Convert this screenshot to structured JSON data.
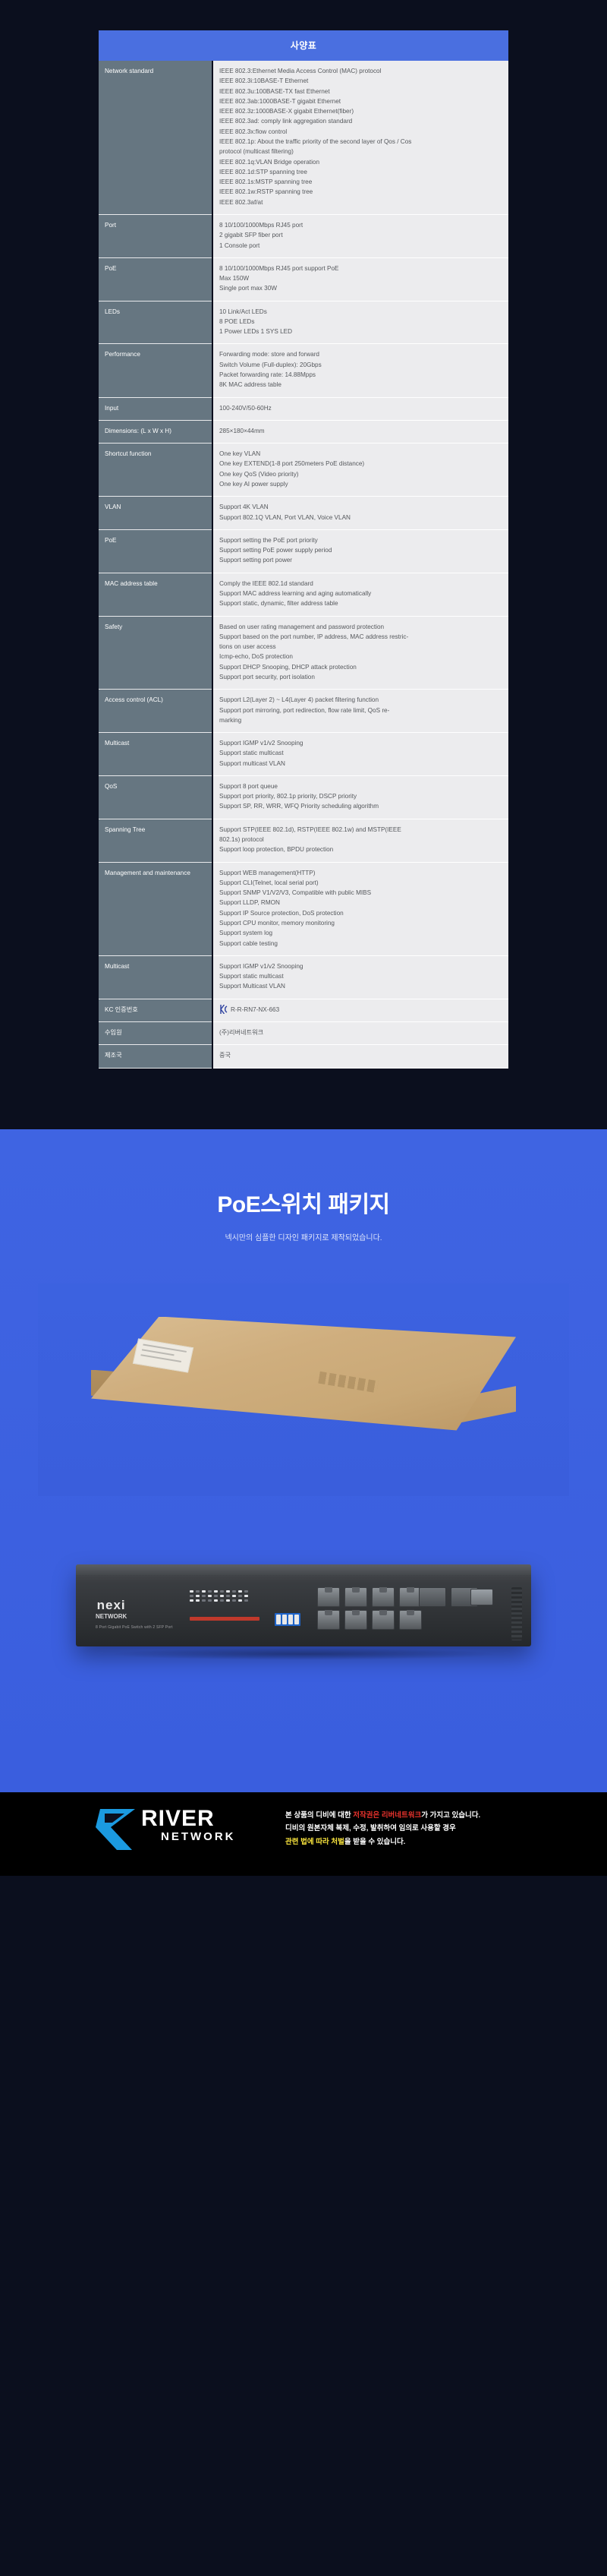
{
  "spec": {
    "header_title": "사양표",
    "rows": [
      {
        "label": "Network standard",
        "lines": [
          "IEEE 802.3:Ethernet Media Access Control (MAC) protocol",
          "IEEE 802.3i:10BASE-T Ethernet",
          "IEEE 802.3u:100BASE-TX fast Ethernet",
          "IEEE 802.3ab:1000BASE-T gigabit Ethernet",
          "IEEE 802.3z:1000BASE-X gigabit Ethernet(fiber)",
          "IEEE 802.3ad: comply link aggregation standard",
          "IEEE 802.3x:flow control",
          "IEEE 802.1p: About the traffic priority of the second layer of Qos / Cos",
          "protocol (multicast filtering)",
          "IEEE 802.1q:VLAN Bridge operation",
          "IEEE 802.1d:STP spanning tree",
          "IEEE 802.1s:MSTP spanning tree",
          "IEEE 802.1w:RSTP spanning tree",
          "IEEE 802.3af/at"
        ]
      },
      {
        "label": "Port",
        "lines": [
          "8 10/100/1000Mbps RJ45 port",
          "2 gigabit SFP fiber port",
          "1 Console port"
        ]
      },
      {
        "label": "PoE",
        "lines": [
          "8 10/100/1000Mbps RJ45 port support PoE",
          "Max 150W",
          "Single port max 30W"
        ]
      },
      {
        "label": "LEDs",
        "lines": [
          "10 Link/Act LEDs",
          "8 POE LEDs",
          "1 Power LEDs 1 SYS LED"
        ]
      },
      {
        "label": "Performance",
        "lines": [
          "Forwarding mode: store and forward",
          "Switch Volume (Full-duplex): 20Gbps",
          "Packet forwarding rate: 14.88Mpps",
          "8K MAC address table"
        ]
      },
      {
        "label": "Input",
        "lines": [
          "100-240V/50-60Hz"
        ]
      },
      {
        "label": "Dimensions: (L x W x H)",
        "lines": [
          "285×180×44mm"
        ]
      },
      {
        "label": "Shortcut function",
        "lines": [
          "One key VLAN",
          "One key EXTEND(1-8 port 250meters PoE distance)",
          "One key QoS (Video priority)",
          "One key AI power supply"
        ]
      },
      {
        "label": "VLAN",
        "lines": [
          "Support 4K VLAN",
          "Support 802.1Q VLAN, Port VLAN, Voice VLAN"
        ]
      },
      {
        "label": "PoE",
        "lines": [
          "Support setting the PoE port priority",
          "Support setting PoE power supply period",
          "Support setting port power"
        ]
      },
      {
        "label": "MAC address table",
        "lines": [
          "Comply the IEEE 802.1d standard",
          "Support MAC address learning and aging automatically",
          "Support static, dynamic, filter address table"
        ]
      },
      {
        "label": "Safety",
        "lines": [
          "Based on user rating management and password protection",
          "Support based on the port number, IP address, MAC address restric-",
          "tions on user access",
          "Icmp-echo, DoS protection",
          "Support DHCP Snooping, DHCP attack protection",
          "Support port security, port isolation"
        ]
      },
      {
        "label": "Access control (ACL)",
        "lines": [
          "Support L2(Layer 2) ~ L4(Layer 4) packet filtering function",
          "Support port mirroring, port redirection, flow rate limit, QoS re-",
          "marking"
        ]
      },
      {
        "label": "Multicast",
        "lines": [
          "Support IGMP v1/v2 Snooping",
          "Support static multicast",
          "Support multicast VLAN"
        ]
      },
      {
        "label": "QoS",
        "lines": [
          "Support 8 port queue",
          "Support port priority, 802.1p priority, DSCP priority",
          "Support SP, RR, WRR, WFQ Priority scheduling algorithm"
        ]
      },
      {
        "label": "Spanning Tree",
        "lines": [
          "Support STP(IEEE 802.1d), RSTP(IEEE 802.1w) and MSTP(IEEE",
          "802.1s) protocol",
          "Support loop protection, BPDU protection"
        ]
      },
      {
        "label": "Management and maintenance",
        "lines": [
          "Support WEB management(HTTP)",
          "Support CLI(Telnet, local serial port)",
          "Support SNMP V1/V2/V3, Compatible with public MIBS",
          "Support LLDP, RMON",
          "Support IP Source protection, DoS protection",
          "Support CPU monitor, memory monitoring",
          "Support system log",
          "Support cable testing"
        ]
      },
      {
        "label": "Multicast",
        "lines": [
          "Support IGMP v1/v2 Snooping",
          "Support static multicast",
          "Support Multicast VLAN"
        ]
      },
      {
        "label": "KC 인증번호",
        "kc_icon": "kc-certification-mark",
        "lines": [
          "R-R-RN7-NX-663"
        ]
      },
      {
        "label": "수입원",
        "lines": [
          "(주)리버네트워크"
        ]
      },
      {
        "label": "제조국",
        "lines": [
          "중국"
        ]
      }
    ]
  },
  "package": {
    "title": "PoE스위치 패키지",
    "subtitle": "넥시만의 심플한 디자인 패키지로 제작되었습니다.",
    "box_photo_name": "product-box-photo",
    "switch_photo_name": "poe-switch-photo",
    "switch_brand": "nexi",
    "switch_brand_sub": "NETWORK",
    "switch_model": "8 Port Gigabit PoE Switch with 2 SFP Port"
  },
  "footer": {
    "logo_main": "RIVER",
    "logo_sub": "NETWORK",
    "line1_a": "본 상품의 디비에 대한 ",
    "line1_b": "저작권은 리버네트워크",
    "line1_c": "가 가지고 있습니다.",
    "line2": "디비의 원본자체 복제, 수정, 발취하여 임의로 사용할 경우",
    "line3_a": "관련 법에 따라 ",
    "line3_b": "처벌",
    "line3_c": "을 받을 수 있습니다."
  },
  "colors": {
    "header_blue": "#4a6fe0",
    "package_blue": "#3d63e0",
    "label_gray": "#667681",
    "value_gray": "#ececee",
    "page_navy": "#0b0f1e",
    "accent_red": "#e8322c",
    "accent_yellow": "#f5e03c"
  }
}
